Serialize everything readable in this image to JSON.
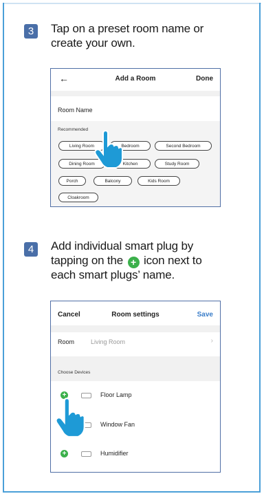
{
  "step3": {
    "number": "3",
    "text_line1": "Tap on a preset room name or",
    "text_line2": "create your own."
  },
  "add_room_screen": {
    "back_icon": "back-arrow-icon",
    "title": "Add a Room",
    "done": "Done",
    "room_name_label": "Room Name",
    "recommended_label": "Recommended",
    "chips": [
      "Living Room",
      "Bedroom",
      "Second Bedroom",
      "Dining Room",
      "Kitchen",
      "Study Room",
      "Porch",
      "Balcony",
      "Kids Room",
      "Cloakroom"
    ]
  },
  "step4": {
    "number": "4",
    "text_line1": "Add individual smart plug by",
    "text_line2a": "tapping on the",
    "text_line2b": "icon next to",
    "text_line3": "each smart plugs’ name.",
    "plus_icon": "plus-circle-icon"
  },
  "room_settings_screen": {
    "cancel": "Cancel",
    "title": "Room settings",
    "save": "Save",
    "room_label": "Room",
    "room_value": "Living Room",
    "choose_devices_label": "Choose Devices",
    "devices": [
      "Floor Lamp",
      "Window Fan",
      "Humidifier"
    ]
  },
  "colors": {
    "step_badge": "#4a6fa8",
    "frame_border": "#4a9fd8",
    "plus_green": "#3bb04b",
    "save_blue": "#3a7dc9",
    "hand_blue": "#1e9ad6"
  }
}
